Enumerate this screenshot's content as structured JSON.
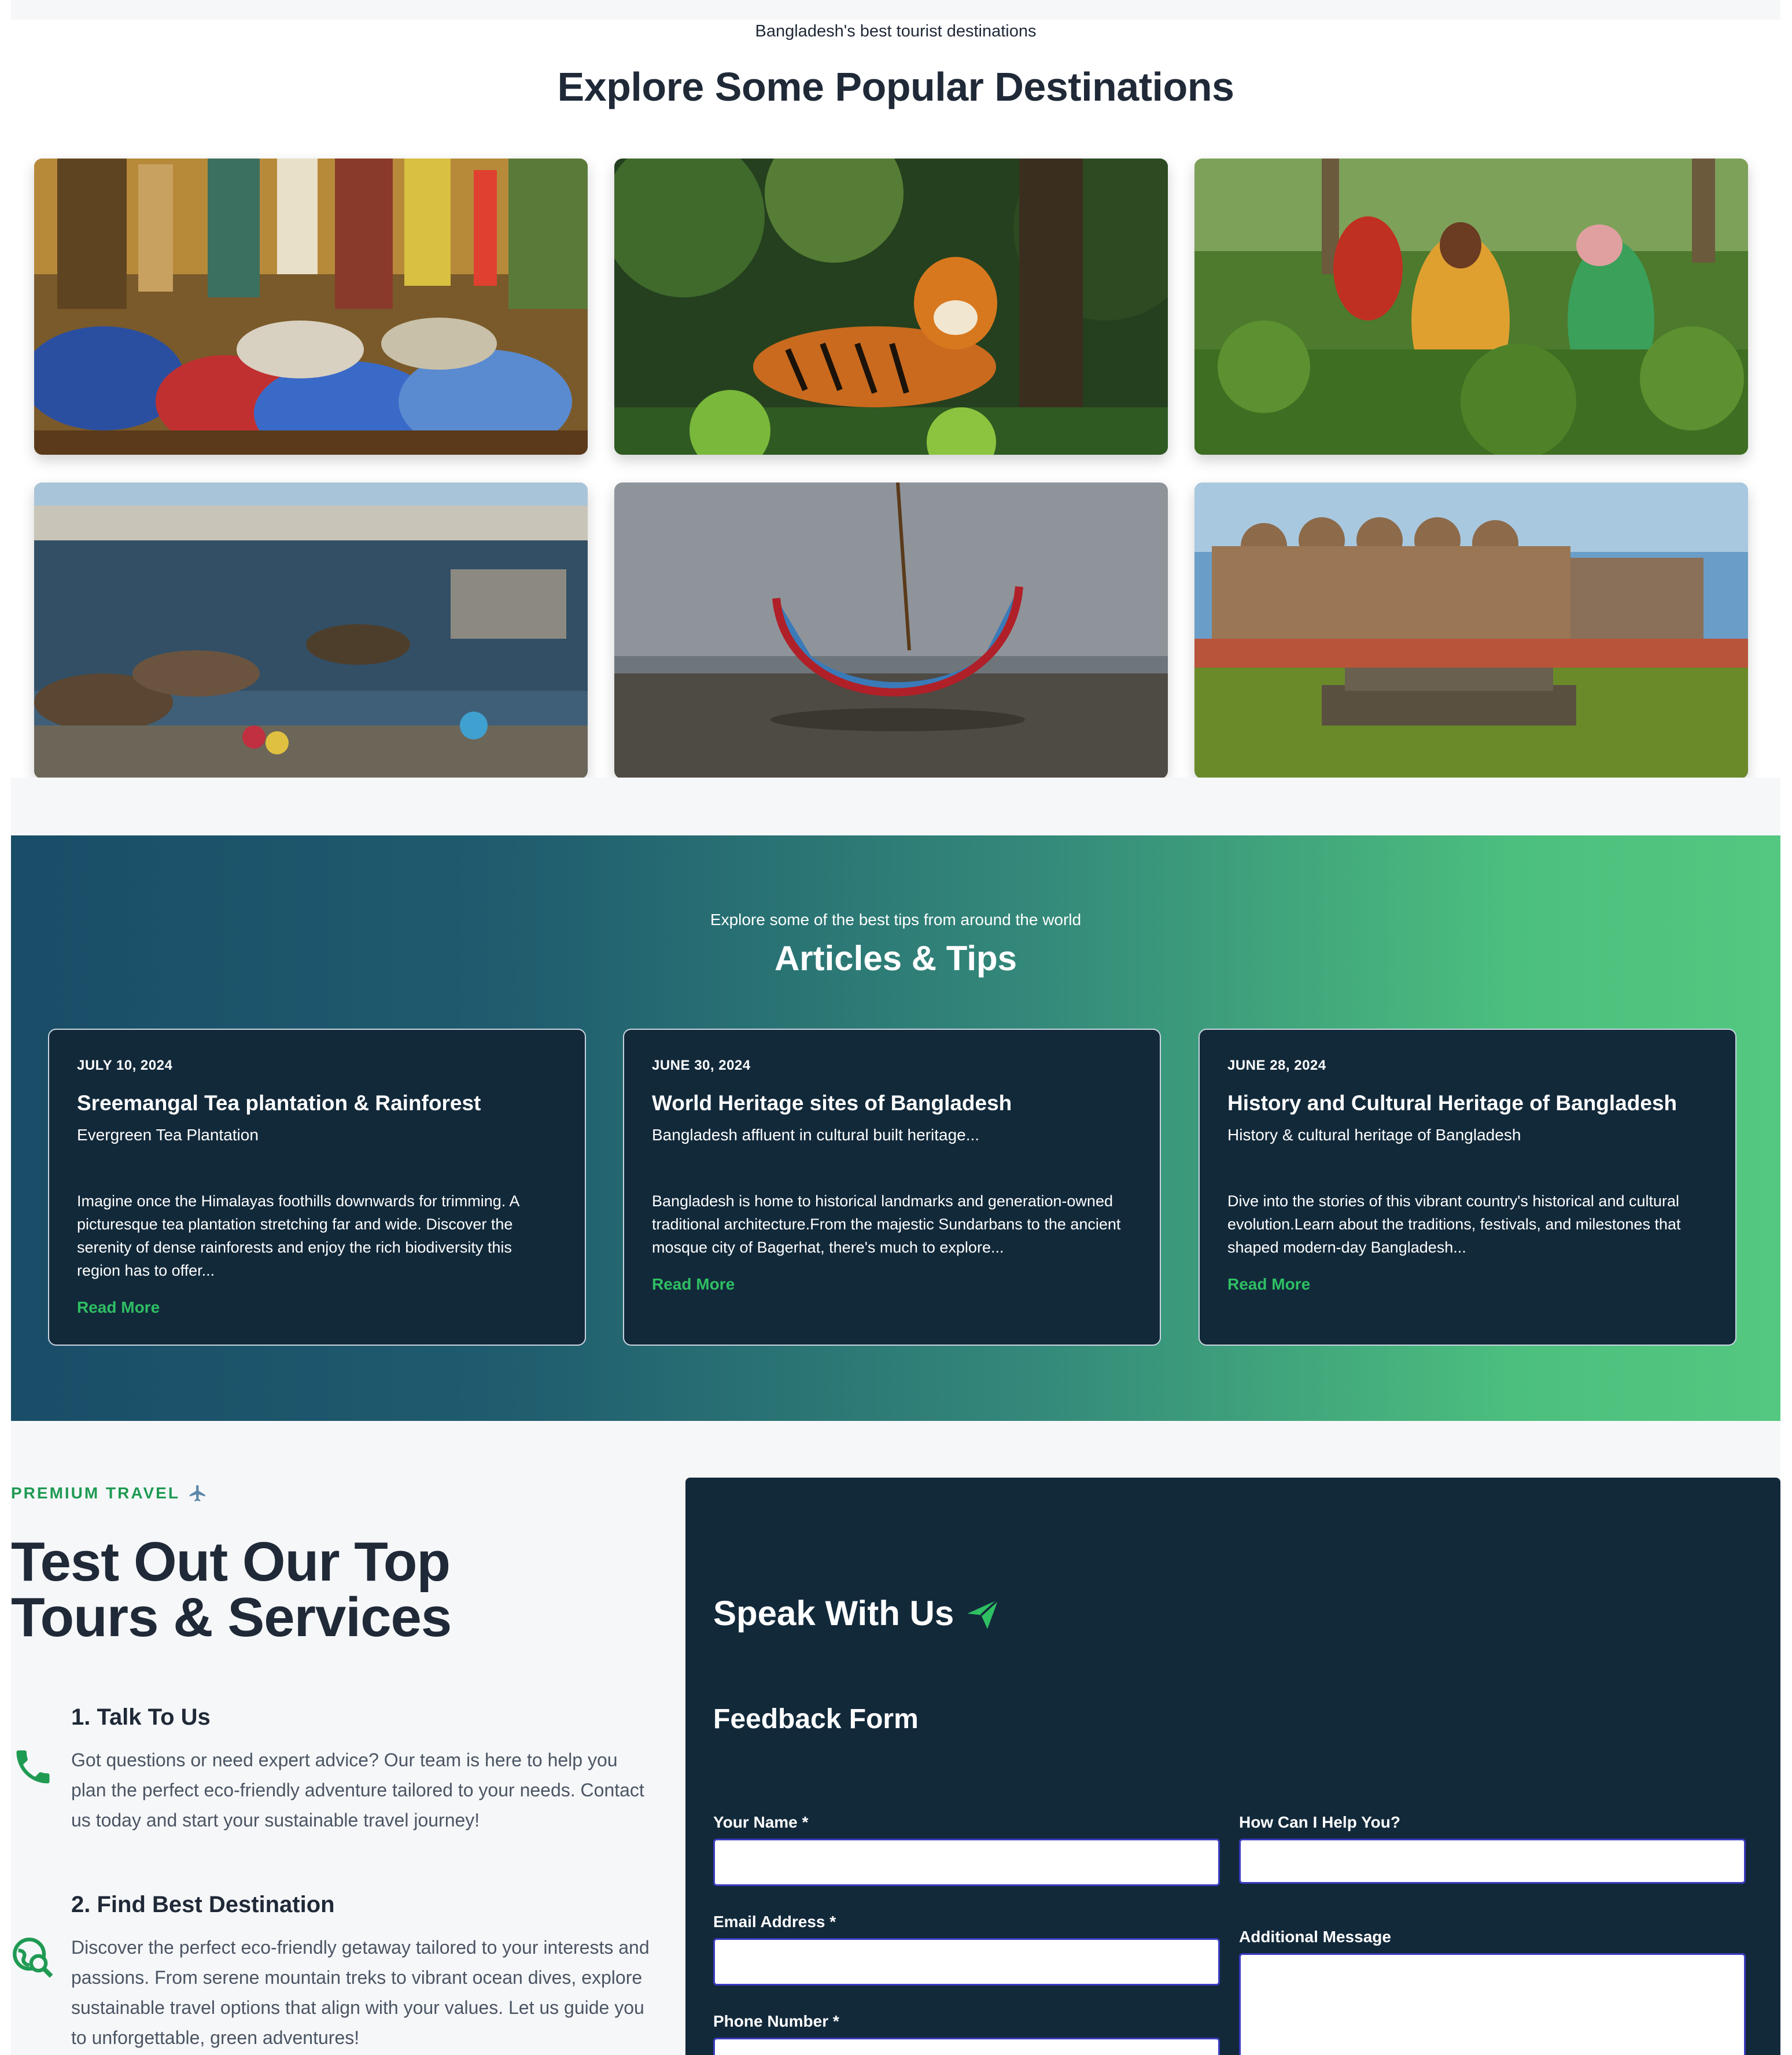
{
  "destinations": {
    "subtitle": "Bangladesh's best tourist destinations",
    "title": "Explore Some Popular Destinations",
    "images": [
      "busy-market-street-rickshaws",
      "bengal-tiger-forest",
      "tea-plantation-workers",
      "river-boats-old-dhaka",
      "traditional-boat-on-beach",
      "ancient-mosque-ruins"
    ]
  },
  "articles": {
    "subtitle": "Explore some of the best tips from around the world",
    "title": "Articles & Tips",
    "items": [
      {
        "date": "JULY 10, 2024",
        "title": "Sreemangal Tea plantation & Rainforest",
        "subtitle": "Evergreen Tea Plantation",
        "body": "Imagine once the Himalayas foothills downwards for trimming. A picturesque tea plantation stretching far and wide. Discover the serenity of dense rainforests and enjoy the rich biodiversity this region has to offer...",
        "link": "Read More"
      },
      {
        "date": "JUNE 30, 2024",
        "title": "World Heritage sites of Bangladesh",
        "subtitle": "Bangladesh affluent in cultural built heritage...",
        "body": "Bangladesh is home to historical landmarks and generation-owned traditional architecture.From the majestic Sundarbans to the ancient mosque city of Bagerhat, there's much to explore...",
        "link": "Read More"
      },
      {
        "date": "JUNE 28, 2024",
        "title": "History and Cultural Heritage of Bangladesh",
        "subtitle": "History & cultural heritage of Bangladesh",
        "body": "Dive into the stories of this vibrant country's historical and cultural evolution.Learn about the traditions, festivals, and milestones that shaped modern-day Bangladesh...",
        "link": "Read More"
      }
    ]
  },
  "services": {
    "eyebrow": "PREMIUM TRAVEL",
    "title_line1": "Test Out Our Top",
    "title_line2": "Tours & Services",
    "steps": [
      {
        "title": "1. Talk To Us",
        "body": "Got questions or need expert advice? Our team is here to help you plan the perfect eco-friendly adventure tailored to your needs. Contact us today and start your sustainable travel journey!",
        "icon": "phone-icon"
      },
      {
        "title": "2. Find Best Destination",
        "body": "Discover the perfect eco-friendly getaway tailored to your interests and passions. From serene mountain treks to vibrant ocean dives, explore sustainable travel options that align with your values. Let us guide you to unforgettable, green adventures!",
        "icon": "globe-search-icon"
      }
    ]
  },
  "contact": {
    "title": "Speak With Us",
    "form_title": "Feedback Form",
    "fields": {
      "name": {
        "label": "Your Name *",
        "value": ""
      },
      "help": {
        "label": "How Can I Help You?",
        "value": ""
      },
      "email": {
        "label": "Email Address *",
        "value": ""
      },
      "message": {
        "label": "Additional Message",
        "value": ""
      },
      "phone": {
        "label": "Phone Number *",
        "value": ""
      }
    }
  },
  "colors": {
    "accent_green": "#2fbf63",
    "navy": "#12293a",
    "heading": "#1f2937"
  }
}
